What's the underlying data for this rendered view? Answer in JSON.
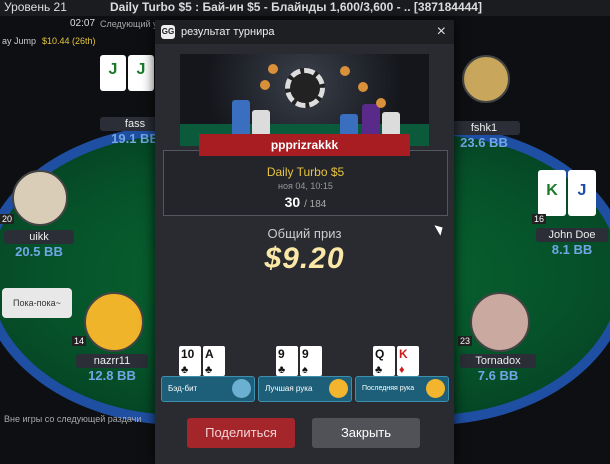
{
  "window": {
    "title": "Daily Turbo $5 : Бай-ин $5 - Блайнды 1,600/3,600 - .. [387184444]",
    "level": "Уровень 21",
    "clock": "02:07",
    "next_level": "Следующий уров",
    "table_name": "ay Jump",
    "table_info": "$10.44 (26th)"
  },
  "players": [
    {
      "name": "fass",
      "stack": "19.1 BB"
    },
    {
      "name": "fshk1",
      "stack": "23.6 BB"
    },
    {
      "name": "uikk",
      "stack": "20.5 BB",
      "seat_badge": "20"
    },
    {
      "name": "John Doe",
      "stack": "8.1 BB",
      "seat_badge": "16"
    },
    {
      "name": "nazrr11",
      "stack": "12.8 BB",
      "seat_badge": "14"
    },
    {
      "name": "Tornadox",
      "stack": "7.6 BB",
      "seat_badge": "23"
    }
  ],
  "chat_bubble": "Пока-пока~",
  "bottom_text": "Вне игры со следующей раздачи",
  "modal": {
    "logo": "GG",
    "title": "результат турнира",
    "close_icon": "×",
    "winner": "ppprizrakkk",
    "tournament": "Daily Turbo $5",
    "date": "ноя 04, 10:15",
    "place": "30",
    "total": "/ 184",
    "prize_label": "Общий приз",
    "prize_value": "$9.20",
    "achievements": [
      {
        "label": "Бэд-бит",
        "cards": [
          {
            "rank": "10",
            "suit": "♣",
            "red": false
          },
          {
            "rank": "A",
            "suit": "♣",
            "red": false
          }
        ]
      },
      {
        "label": "Лучшая рука",
        "cards": [
          {
            "rank": "9",
            "suit": "♣",
            "red": false
          },
          {
            "rank": "9",
            "suit": "♠",
            "red": false
          }
        ]
      },
      {
        "label": "Последняя рука",
        "cards": [
          {
            "rank": "Q",
            "suit": "♣",
            "red": false
          },
          {
            "rank": "K",
            "suit": "♦",
            "red": true
          }
        ]
      }
    ],
    "share_label": "Поделиться",
    "close_label": "Закрыть"
  },
  "colors": {
    "accent_red": "#a5262a",
    "felt_green": "#0a6b32",
    "table_rim": "#1f4fa3",
    "prize_gold": "#fbe8a6"
  }
}
